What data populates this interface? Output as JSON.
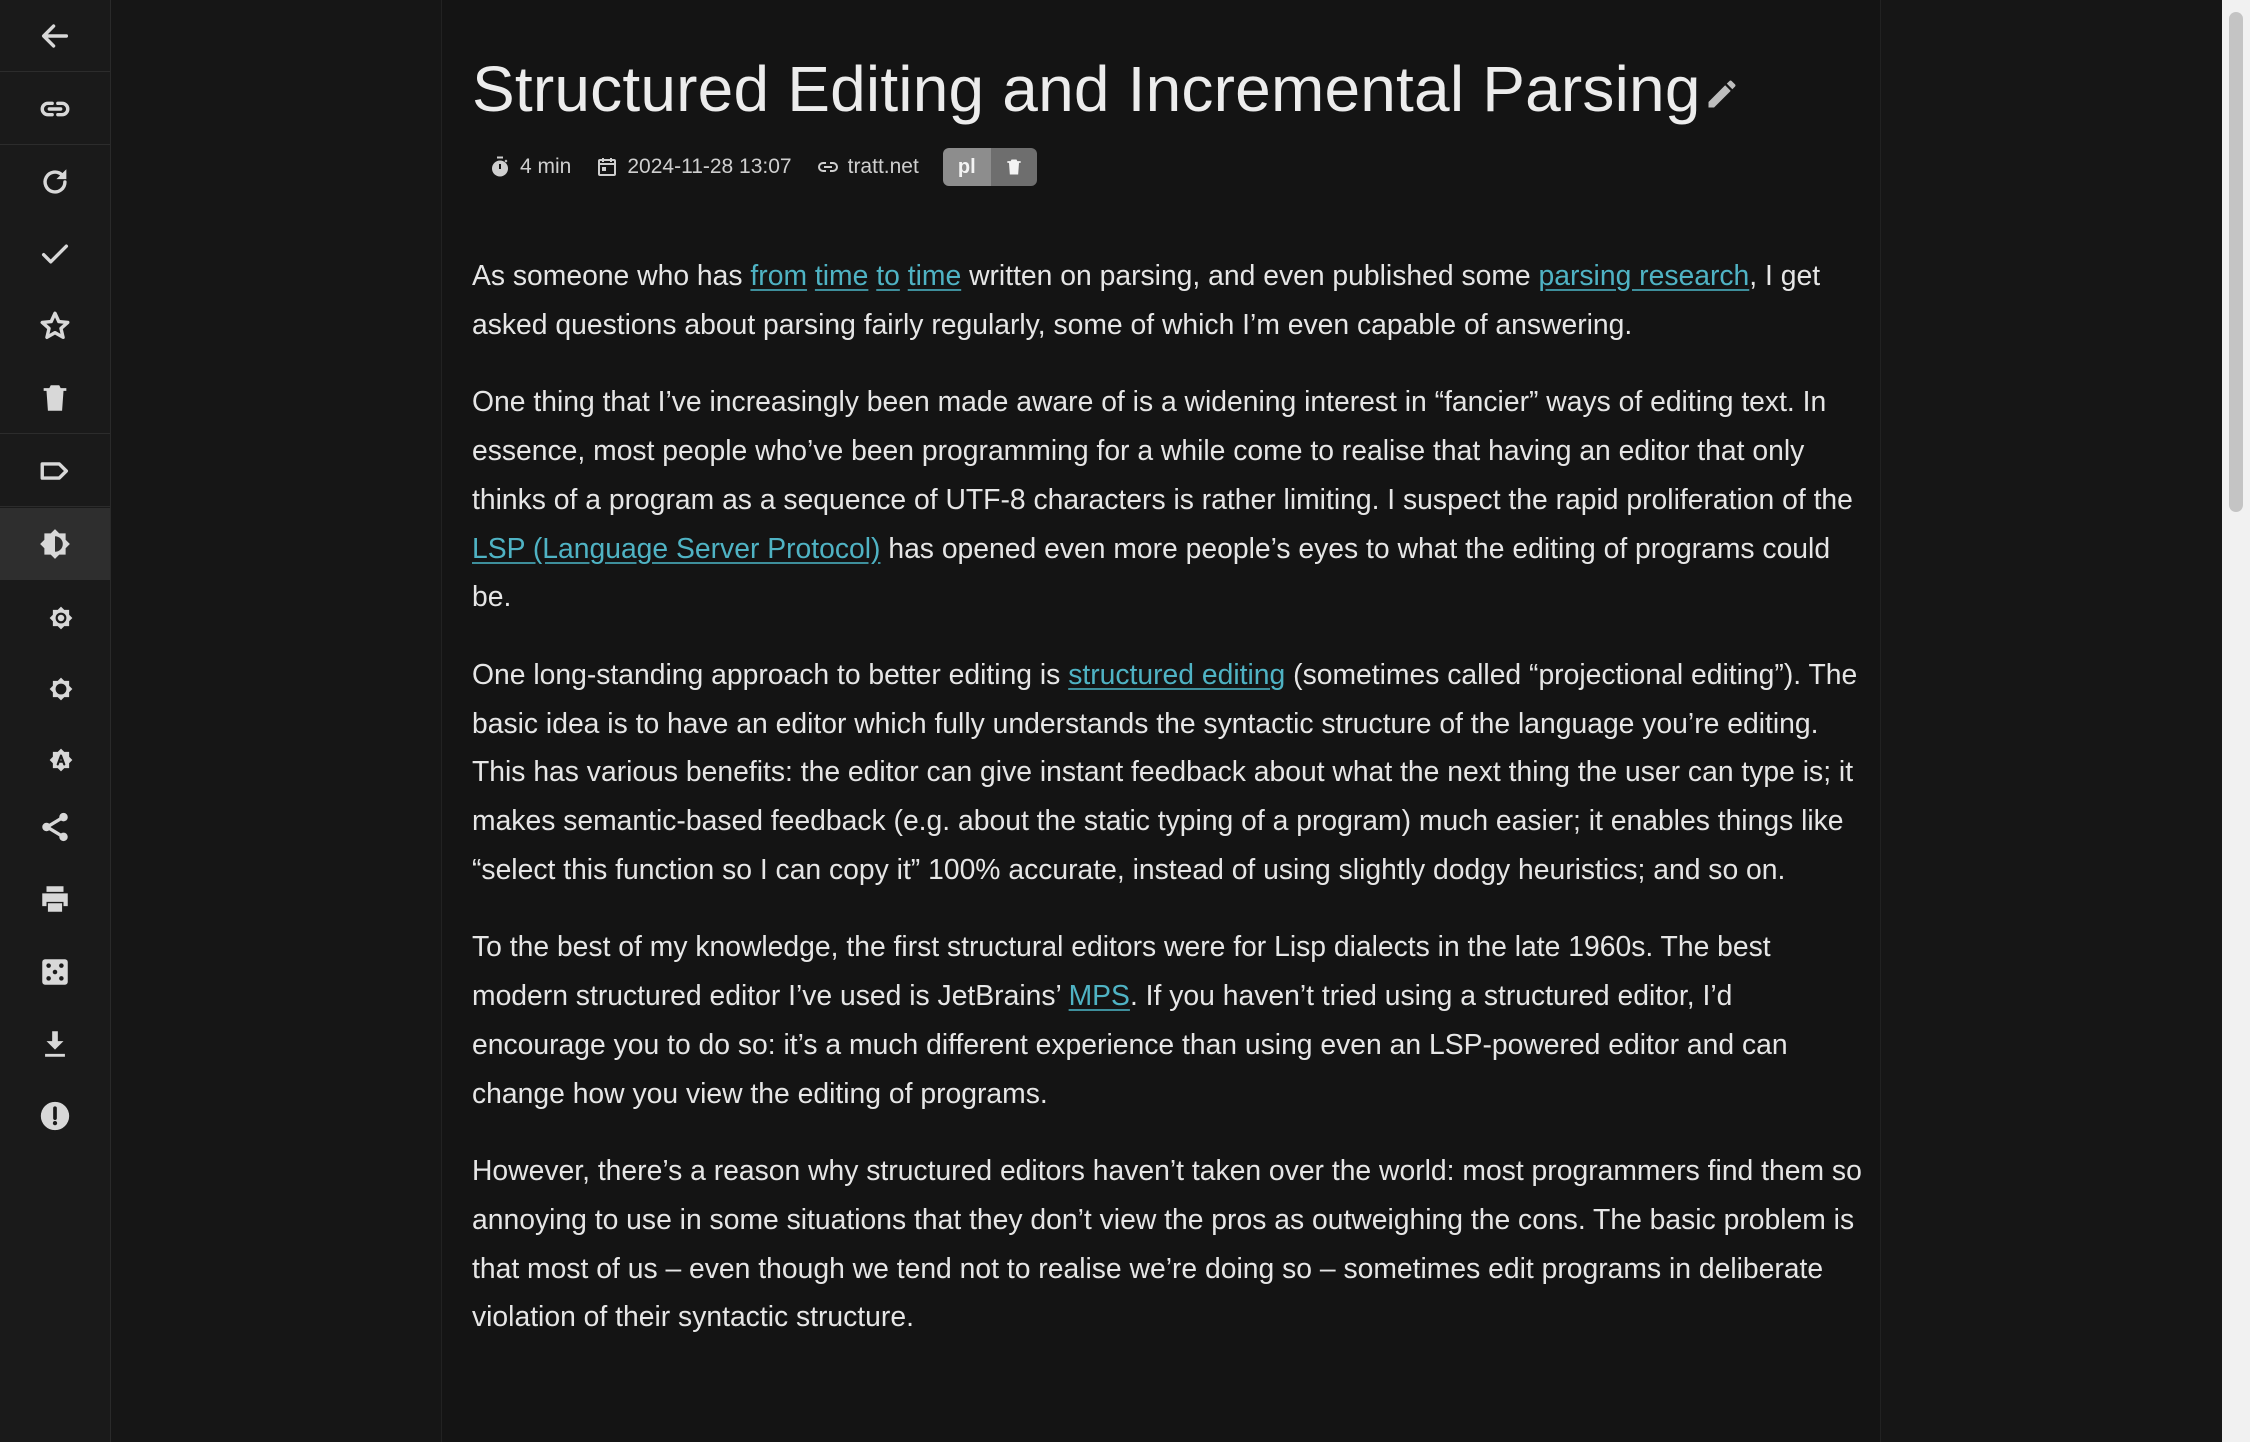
{
  "sidebar": {
    "items": [
      {
        "icon": "arrow-left-icon",
        "name": "back-button"
      },
      {
        "icon": "link-icon",
        "name": "open-link-button"
      },
      {
        "icon": "refresh-icon",
        "name": "refresh-button"
      },
      {
        "icon": "check-icon",
        "name": "mark-read-button"
      },
      {
        "icon": "star-icon",
        "name": "star-button"
      },
      {
        "icon": "trash-icon",
        "name": "delete-button"
      },
      {
        "icon": "label-icon",
        "name": "label-button"
      },
      {
        "icon": "brightness-icon",
        "name": "theme-button"
      },
      {
        "icon": "brightness-high-icon",
        "name": "theme-light-button"
      },
      {
        "icon": "brightness-low-icon",
        "name": "theme-dark-button"
      },
      {
        "icon": "brightness-auto-icon",
        "name": "theme-auto-button"
      },
      {
        "icon": "share-icon",
        "name": "share-button"
      },
      {
        "icon": "print-icon",
        "name": "print-button"
      },
      {
        "icon": "dice-icon",
        "name": "random-button"
      },
      {
        "icon": "download-icon",
        "name": "download-button"
      },
      {
        "icon": "alert-icon",
        "name": "report-button"
      }
    ]
  },
  "article": {
    "title": "Structured Editing and Incremental Parsing",
    "meta": {
      "reading_time": "4 min",
      "date": "2024-11-28 13:07",
      "source": "tratt.net",
      "tag": "pl"
    },
    "paragraphs": [
      [
        {
          "t": "As someone who has "
        },
        {
          "t": "from",
          "link": true
        },
        {
          "t": " "
        },
        {
          "t": "time",
          "link": true
        },
        {
          "t": " "
        },
        {
          "t": "to",
          "link": true
        },
        {
          "t": " "
        },
        {
          "t": "time",
          "link": true
        },
        {
          "t": " written on parsing, and even published some "
        },
        {
          "t": "parsing research",
          "link": true
        },
        {
          "t": ", I get asked questions about parsing fairly regularly, some of which I’m even capable of answering."
        }
      ],
      [
        {
          "t": "One thing that I’ve increasingly been made aware of is a widening interest in “fancier” ways of editing text. In essence, most people who’ve been programming for a while come to realise that having an editor that only thinks of a program as a sequence of UTF-8 characters is rather limiting. I suspect the rapid proliferation of the "
        },
        {
          "t": "LSP (Language Server Protocol)",
          "link": true
        },
        {
          "t": " has opened even more people’s eyes to what the editing of programs could be."
        }
      ],
      [
        {
          "t": "One long-standing approach to better editing is "
        },
        {
          "t": "structured editing",
          "link": true
        },
        {
          "t": " (sometimes called “projectional editing”). The basic idea is to have an editor which fully understands the syntactic structure of the language you’re editing. This has various benefits: the editor can give instant feedback about what the next thing the user can type is; it makes semantic-based feedback (e.g. about the static typing of a program) much easier; it enables things like “select this function so I can copy it” 100% accurate, instead of using slightly dodgy heuristics; and so on."
        }
      ],
      [
        {
          "t": "To the best of my knowledge, the first structural editors were for Lisp dialects in the late 1960s. The best modern structured editor I’ve used is JetBrains’ "
        },
        {
          "t": "MPS",
          "link": true
        },
        {
          "t": ". If you haven’t tried using a structured editor, I’d encourage you to do so: it’s a much different experience than using even an LSP-powered editor and can change how you view the editing of programs."
        }
      ],
      [
        {
          "t": "However, there’s a reason why structured editors haven’t taken over the world: most programmers find them so annoying to use in some situations that they don’t view the pros as outweighing the cons. The basic problem is that most of us – even though we tend not to realise we’re doing so – sometimes edit programs in deliberate violation of their syntactic structure."
        }
      ]
    ]
  }
}
